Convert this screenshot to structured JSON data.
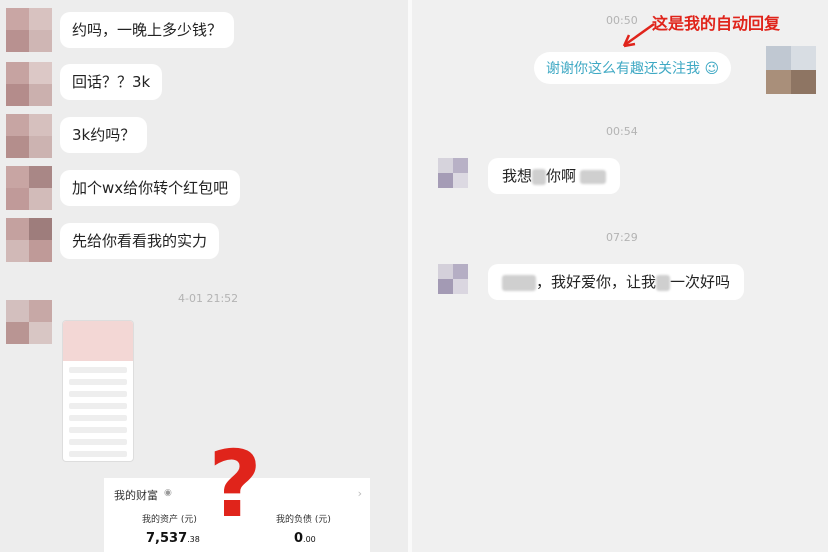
{
  "left_chat": {
    "messages": [
      {
        "text": "约吗，一晚上多少钱？"
      },
      {
        "text": "回话？？3k"
      },
      {
        "text": "3k约吗？"
      },
      {
        "text": "加个wx给你转个红包吧"
      },
      {
        "text": "先给你看看我的实力"
      }
    ],
    "timestamp": "4-01 21:52",
    "wealth_card": {
      "title": "我的财富",
      "assets_label": "我的资产 (元)",
      "assets_int": "7,537",
      "assets_dec": ".38",
      "debt_label": "我的负债 (元)",
      "debt_int": "0",
      "debt_dec": ".00"
    },
    "question_mark": "?"
  },
  "right_chat": {
    "time1": "00:50",
    "annotation": "这是我的自动回复",
    "auto_reply": "谢谢你这么有趣还关注我",
    "auto_reply_emoji": "😉",
    "time2": "00:54",
    "msg2_a": "我想",
    "msg2_b": "你啊",
    "time3": "07:29",
    "msg3_a": "，我好爱你，让我",
    "msg3_b": "一次好吗"
  },
  "colors": {
    "annotation_red": "#e0241b",
    "auto_reply_blue": "#3fa9c4",
    "bubble_bg": "#ffffff",
    "chat_bg": "#ededed"
  }
}
